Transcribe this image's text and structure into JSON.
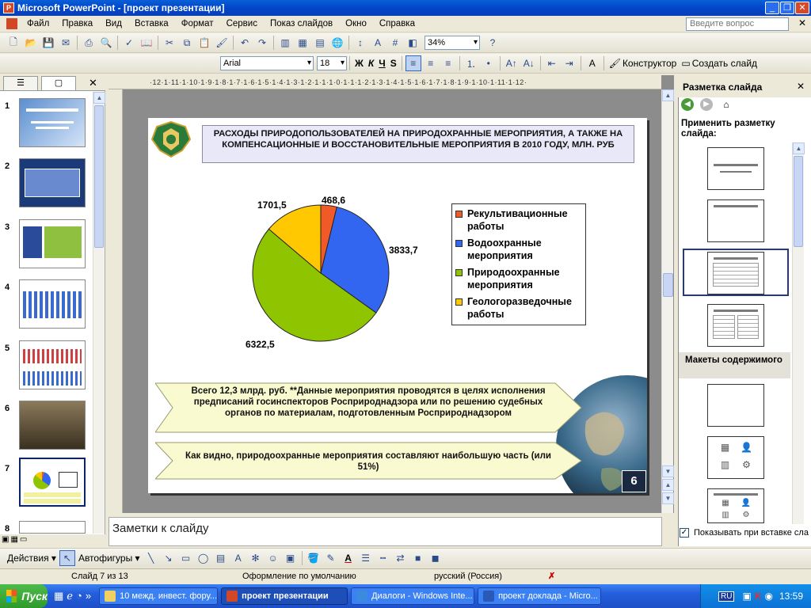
{
  "window": {
    "title": "Microsoft PowerPoint - [проект презентации]"
  },
  "menu": {
    "items": [
      "Файл",
      "Правка",
      "Вид",
      "Вставка",
      "Формат",
      "Сервис",
      "Показ слайдов",
      "Окно",
      "Справка"
    ],
    "ask_placeholder": "Введите вопрос"
  },
  "toolbar": {
    "zoom": "34%"
  },
  "format_toolbar": {
    "font": "Arial",
    "size": "18",
    "bold": "Ж",
    "italic": "К",
    "underline": "Ч",
    "shadow": "S",
    "designer": "Конструктор",
    "new_slide": "Создать слайд"
  },
  "ruler": {
    "h": "·12·1·11·1·10·1·9·1·8·1·7·1·6·1·5·1·4·1·3·1·2·1·1·1·0·1·1·1·2·1·3·1·4·1·5·1·6·1·7·1·8·1·9·1·10·1·11·1·12·"
  },
  "thumbnails": {
    "numbers": [
      "1",
      "2",
      "3",
      "4",
      "5",
      "6",
      "7",
      "8"
    ]
  },
  "slide": {
    "title": "РАСХОДЫ ПРИРОДОПОЛЬЗОВАТЕЛЕЙ НА ПРИРОДОХРАННЫЕ МЕРОПРИЯТИЯ, А ТАКЖЕ НА КОМПЕНСАЦИОННЫЕ И ВОССТАНОВИТЕЛЬНЫЕ МЕРОПРИЯТИЯ В 2010 ГОДУ, МЛН. РУБ",
    "box1": "Всего 12,3 млрд. руб. **Данные мероприятия проводятся в целях исполнения предписаний госинспекторов Росприроднадзора или по решению судебных органов по материалам, подготовленным Росприроднадзором",
    "box2": "Как видно, природоохранные мероприятия составляют наибольшую часть (или 51%)",
    "number": "6"
  },
  "chart_data": {
    "type": "pie",
    "categories": [
      "Рекультивационные работы",
      "Водоохранные мероприятия",
      "Природоохранные мероприятия",
      "Геологоразведочные работы"
    ],
    "values": [
      468.6,
      3833.7,
      6322.5,
      1701.5
    ],
    "value_labels": [
      "468,6",
      "3833,7",
      "6322,5",
      "1701,5"
    ],
    "colors": [
      "#f05a28",
      "#3266f0",
      "#8fc500",
      "#ffc800"
    ],
    "legend_position": "right"
  },
  "notes": {
    "placeholder": "Заметки к слайду"
  },
  "taskpane": {
    "title": "Разметка слайда",
    "apply_label": "Применить разметку слайда:",
    "content_section": "Макеты содержимого",
    "show_on_insert": "Показывать при вставке сла"
  },
  "drawing": {
    "actions": "Действия",
    "autoshapes": "Автофигуры"
  },
  "status": {
    "slide": "Слайд 7 из 13",
    "design": "Оформление по умолчанию",
    "language": "русский (Россия)"
  },
  "taskbar": {
    "start": "Пуск",
    "tasks": [
      "10 межд. инвест. фору...",
      "проект презентации",
      "Диалоги - Windows Inte...",
      "проект доклада - Micro..."
    ],
    "lang": "RU",
    "time": "13:59"
  }
}
